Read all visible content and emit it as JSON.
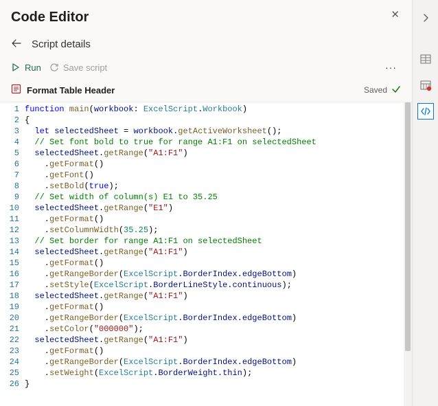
{
  "header": {
    "title": "Code Editor",
    "subtitle": "Script details"
  },
  "toolbar": {
    "run_label": "Run",
    "save_label": "Save script",
    "more_label": "···"
  },
  "script": {
    "name": "Format Table Header",
    "status_label": "Saved"
  },
  "code": {
    "lines": [
      {
        "n": 1,
        "tokens": [
          [
            "kw",
            "function"
          ],
          [
            "",
            ""
          ],
          [
            "func",
            " main"
          ],
          [
            "punct",
            "("
          ],
          [
            "ident",
            "workbook"
          ],
          [
            "punct",
            ": "
          ],
          [
            "type",
            "ExcelScript"
          ],
          [
            "punct",
            "."
          ],
          [
            "type",
            "Workbook"
          ],
          [
            "punct",
            ")"
          ]
        ]
      },
      {
        "n": 2,
        "tokens": [
          [
            "punct",
            "{"
          ]
        ]
      },
      {
        "n": 3,
        "tokens": [
          [
            "",
            "  "
          ],
          [
            "kw",
            "let"
          ],
          [
            "",
            " "
          ],
          [
            "ident",
            "selectedSheet"
          ],
          [
            "punct",
            " = "
          ],
          [
            "ident",
            "workbook"
          ],
          [
            "punct",
            "."
          ],
          [
            "func",
            "getActiveWorksheet"
          ],
          [
            "punct",
            "();"
          ]
        ]
      },
      {
        "n": 4,
        "tokens": [
          [
            "",
            "  "
          ],
          [
            "cmt",
            "// Set font bold to true for range A1:F1 on selectedSheet"
          ]
        ]
      },
      {
        "n": 5,
        "tokens": [
          [
            "",
            "  "
          ],
          [
            "ident",
            "selectedSheet"
          ],
          [
            "punct",
            "."
          ],
          [
            "func",
            "getRange"
          ],
          [
            "punct",
            "("
          ],
          [
            "str",
            "\"A1:F1\""
          ],
          [
            "punct",
            ")"
          ]
        ]
      },
      {
        "n": 6,
        "tokens": [
          [
            "",
            "    ."
          ],
          [
            "func",
            "getFormat"
          ],
          [
            "punct",
            "()"
          ]
        ]
      },
      {
        "n": 7,
        "tokens": [
          [
            "",
            "    ."
          ],
          [
            "func",
            "getFont"
          ],
          [
            "punct",
            "()"
          ]
        ]
      },
      {
        "n": 8,
        "tokens": [
          [
            "",
            "    ."
          ],
          [
            "func",
            "setBold"
          ],
          [
            "punct",
            "("
          ],
          [
            "bool",
            "true"
          ],
          [
            "punct",
            ");"
          ]
        ]
      },
      {
        "n": 9,
        "tokens": [
          [
            "",
            "  "
          ],
          [
            "cmt",
            "// Set width of column(s) E1 to 35.25"
          ]
        ]
      },
      {
        "n": 10,
        "tokens": [
          [
            "",
            "  "
          ],
          [
            "ident",
            "selectedSheet"
          ],
          [
            "punct",
            "."
          ],
          [
            "func",
            "getRange"
          ],
          [
            "punct",
            "("
          ],
          [
            "str",
            "\"E1\""
          ],
          [
            "punct",
            ")"
          ]
        ]
      },
      {
        "n": 11,
        "tokens": [
          [
            "",
            "    ."
          ],
          [
            "func",
            "getFormat"
          ],
          [
            "punct",
            "()"
          ]
        ]
      },
      {
        "n": 12,
        "tokens": [
          [
            "",
            "    ."
          ],
          [
            "func",
            "setColumnWidth"
          ],
          [
            "punct",
            "("
          ],
          [
            "num",
            "35.25"
          ],
          [
            "punct",
            ");"
          ]
        ]
      },
      {
        "n": 13,
        "tokens": [
          [
            "",
            "  "
          ],
          [
            "cmt",
            "// Set border for range A1:F1 on selectedSheet"
          ]
        ]
      },
      {
        "n": 14,
        "tokens": [
          [
            "",
            "  "
          ],
          [
            "ident",
            "selectedSheet"
          ],
          [
            "punct",
            "."
          ],
          [
            "func",
            "getRange"
          ],
          [
            "punct",
            "("
          ],
          [
            "str",
            "\"A1:F1\""
          ],
          [
            "punct",
            ")"
          ]
        ]
      },
      {
        "n": 15,
        "tokens": [
          [
            "",
            "    ."
          ],
          [
            "func",
            "getFormat"
          ],
          [
            "punct",
            "()"
          ]
        ]
      },
      {
        "n": 16,
        "tokens": [
          [
            "",
            "    ."
          ],
          [
            "func",
            "getRangeBorder"
          ],
          [
            "punct",
            "("
          ],
          [
            "type",
            "ExcelScript"
          ],
          [
            "punct",
            "."
          ],
          [
            "ident",
            "BorderIndex"
          ],
          [
            "punct",
            "."
          ],
          [
            "ident",
            "edgeBottom"
          ],
          [
            "punct",
            ")"
          ]
        ]
      },
      {
        "n": 17,
        "tokens": [
          [
            "",
            "    ."
          ],
          [
            "func",
            "setStyle"
          ],
          [
            "punct",
            "("
          ],
          [
            "type",
            "ExcelScript"
          ],
          [
            "punct",
            "."
          ],
          [
            "ident",
            "BorderLineStyle"
          ],
          [
            "punct",
            "."
          ],
          [
            "ident",
            "continuous"
          ],
          [
            "punct",
            ");"
          ]
        ]
      },
      {
        "n": 18,
        "tokens": [
          [
            "",
            "  "
          ],
          [
            "ident",
            "selectedSheet"
          ],
          [
            "punct",
            "."
          ],
          [
            "func",
            "getRange"
          ],
          [
            "punct",
            "("
          ],
          [
            "str",
            "\"A1:F1\""
          ],
          [
            "punct",
            ")"
          ]
        ]
      },
      {
        "n": 19,
        "tokens": [
          [
            "",
            "    ."
          ],
          [
            "func",
            "getFormat"
          ],
          [
            "punct",
            "()"
          ]
        ]
      },
      {
        "n": 20,
        "tokens": [
          [
            "",
            "    ."
          ],
          [
            "func",
            "getRangeBorder"
          ],
          [
            "punct",
            "("
          ],
          [
            "type",
            "ExcelScript"
          ],
          [
            "punct",
            "."
          ],
          [
            "ident",
            "BorderIndex"
          ],
          [
            "punct",
            "."
          ],
          [
            "ident",
            "edgeBottom"
          ],
          [
            "punct",
            ")"
          ]
        ]
      },
      {
        "n": 21,
        "tokens": [
          [
            "",
            "    ."
          ],
          [
            "func",
            "setColor"
          ],
          [
            "punct",
            "("
          ],
          [
            "str",
            "\"000000\""
          ],
          [
            "punct",
            ");"
          ]
        ]
      },
      {
        "n": 22,
        "tokens": [
          [
            "",
            "  "
          ],
          [
            "ident",
            "selectedSheet"
          ],
          [
            "punct",
            "."
          ],
          [
            "func",
            "getRange"
          ],
          [
            "punct",
            "("
          ],
          [
            "str",
            "\"A1:F1\""
          ],
          [
            "punct",
            ")"
          ]
        ]
      },
      {
        "n": 23,
        "tokens": [
          [
            "",
            "    ."
          ],
          [
            "func",
            "getFormat"
          ],
          [
            "punct",
            "()"
          ]
        ]
      },
      {
        "n": 24,
        "tokens": [
          [
            "",
            "    ."
          ],
          [
            "func",
            "getRangeBorder"
          ],
          [
            "punct",
            "("
          ],
          [
            "type",
            "ExcelScript"
          ],
          [
            "punct",
            "."
          ],
          [
            "ident",
            "BorderIndex"
          ],
          [
            "punct",
            "."
          ],
          [
            "ident",
            "edgeBottom"
          ],
          [
            "punct",
            ")"
          ]
        ]
      },
      {
        "n": 25,
        "tokens": [
          [
            "",
            "    ."
          ],
          [
            "func",
            "setWeight"
          ],
          [
            "punct",
            "("
          ],
          [
            "type",
            "ExcelScript"
          ],
          [
            "punct",
            "."
          ],
          [
            "ident",
            "BorderWeight"
          ],
          [
            "punct",
            "."
          ],
          [
            "ident",
            "thin"
          ],
          [
            "punct",
            ");"
          ]
        ]
      },
      {
        "n": 26,
        "tokens": [
          [
            "punct",
            "}"
          ]
        ]
      }
    ]
  },
  "icons": {
    "close": "✕",
    "back": "←",
    "play": "▷",
    "refresh": "↻",
    "script": "▤",
    "check": "✓",
    "chevron_right": "›"
  }
}
